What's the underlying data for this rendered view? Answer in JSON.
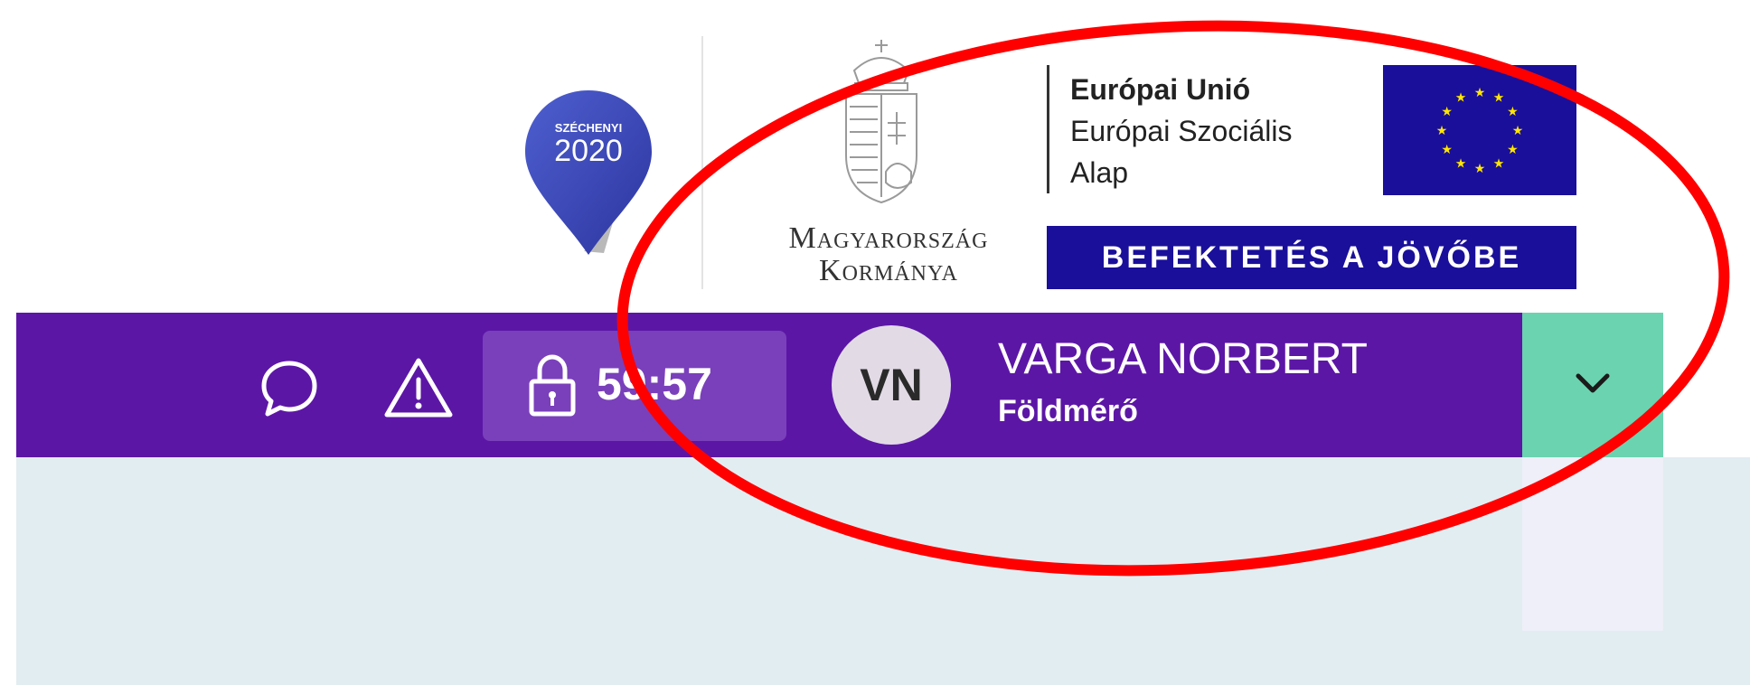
{
  "header": {
    "szechenyi_logo": {
      "line1": "SZÉCHENYI",
      "line2": "2020"
    },
    "government": {
      "line1": "Magyarország",
      "line2": "Kormánya"
    },
    "eu": {
      "title": "Európai Unió",
      "line2": "Európai Szociális",
      "line3": "Alap",
      "slogan": "BEFEKTETÉS A JÖVŐBE"
    }
  },
  "topbar": {
    "background": "#5c16a6",
    "icons": [
      "chat-icon",
      "warning-icon",
      "lock-icon"
    ],
    "timer": "59:57",
    "user": {
      "initials": "VN",
      "name": "VARGA NORBERT",
      "role": "Földmérő"
    },
    "dropdown_icon": "chevron-down-icon",
    "dropdown_color": "#6bd3b0"
  },
  "annotation": {
    "shape": "ellipse",
    "color": "#ff0000"
  }
}
